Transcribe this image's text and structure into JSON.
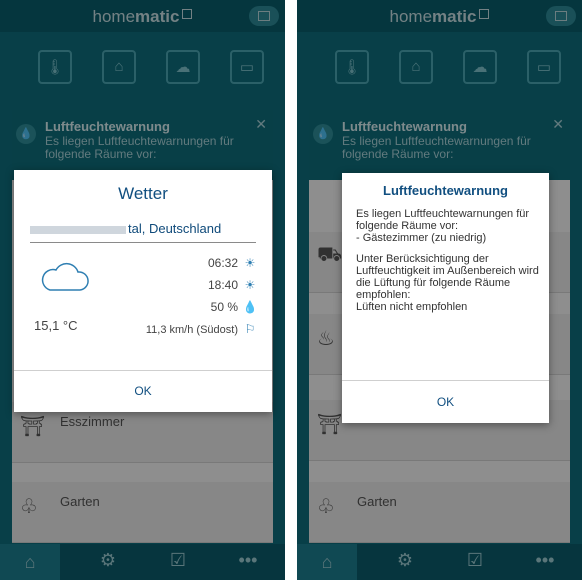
{
  "app": {
    "brand_light": "home",
    "brand_bold": "matic"
  },
  "colors": {
    "bg": "#0e6d7c",
    "dialog_title": "#114f80",
    "dialog_text": "#333333"
  },
  "left": {
    "notice": {
      "title": "Luftfeuchtewarnung",
      "text": "Es liegen Luftfeuchtewarnungen für folgende Räume vor:"
    },
    "rooms": [
      {
        "name": "Esszimmer"
      },
      {
        "name": "Garten"
      }
    ],
    "weather_dialog": {
      "title": "Wetter",
      "location": "tal, Deutschland",
      "temperature": "15,1 °C",
      "sunrise": "06:32",
      "sunset": "18:40",
      "humidity": "50 %",
      "wind": "11,3 km/h (Südost)",
      "ok": "OK"
    }
  },
  "right": {
    "notice": {
      "title": "Luftfeuchtewarnung",
      "text": "Es liegen Luftfeuchtewarnungen für folgende Räume vor:"
    },
    "rooms": [
      {
        "name": "Garten"
      }
    ],
    "warning_dialog": {
      "title": "Luftfeuchtewarnung",
      "lines1": "Es liegen Luftfeuchtewarnungen für folgende Räume vor:",
      "lines2": "- Gästezimmer (zu niedrig)",
      "lines3": "Unter Berücksichtigung der Luftfeuchtigkeit im Außenbereich wird die Lüftung für folgende Räume empfohlen:",
      "lines4": "Lüften nicht empfohlen",
      "ok": "OK"
    }
  }
}
